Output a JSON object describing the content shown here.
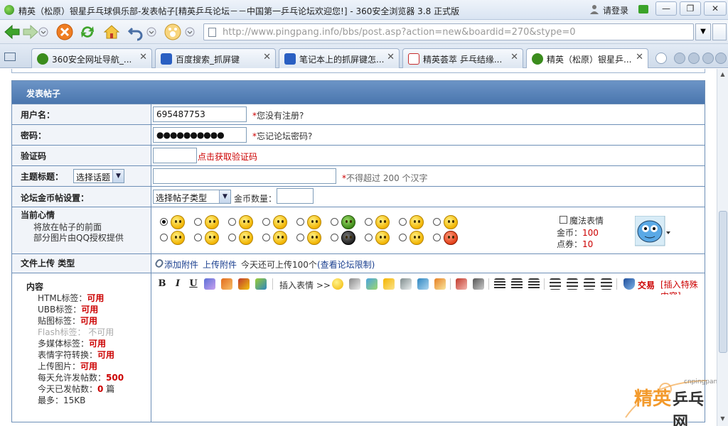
{
  "browser": {
    "title": "精英（松原）银星乒乓球俱乐部-发表帖子[精英乒乓论坛－－中国第一乒乓论坛欢迎您!] - 360安全浏览器 3.8 正式版",
    "login_label": "请登录",
    "url_host": "http://www.pingpang.info",
    "url_path": "/bbs/post.asp?action=new&boardid=270&stype=0",
    "window_buttons": [
      "—",
      "❐",
      "✕"
    ],
    "tabs": [
      {
        "label": "360安全网址导航_...",
        "icon_color": "#3b8c1d"
      },
      {
        "label": "百度搜索_抓屏键",
        "icon_color": "#2a5fc2"
      },
      {
        "label": "笔记本上的抓屏键怎...",
        "icon_color": "#2a5fc2"
      },
      {
        "label": "精英荟萃 乒乓结缘...",
        "icon_color": "#c62b2b"
      },
      {
        "label": "精英（松原）银星乒...",
        "icon_color": "#3b8c1d",
        "active": true
      }
    ]
  },
  "form": {
    "header": "发表帖子",
    "username_label": "用户名：",
    "username_value": "695487753",
    "username_note": "您没有注册?",
    "password_label": "密码：",
    "password_value": "●●●●●●●●●●",
    "password_note": "忘记论坛密码?",
    "captcha_label": "验证码",
    "captcha_link": "点击获取验证码",
    "subject_label": "主题标题：",
    "subject_select": "选择话题",
    "subject_note_prefix": "*",
    "subject_note": "不得超过 200 个汉字",
    "required_star": "*",
    "coin_label": "论坛金币帖设置：",
    "coin_select": "选择帖子类型",
    "coin_amount_label": "金币数量：",
    "mood_label": "当前心情",
    "mood_sub1": "将放在帖子的前面",
    "mood_sub2": "部分图片由QQ授权提供",
    "magic_label": "魔法表情",
    "gold_label": "金币：",
    "gold_value": "100",
    "points_label": "点券：",
    "points_value": "10",
    "upload_label": "文件上传",
    "upload_type": "类型",
    "upload_add": "添加附件",
    "upload_attach": "上传附件",
    "upload_today_prefix": "今天还可上传",
    "upload_today_count": "100",
    "upload_today_suffix": "个",
    "upload_limit_link": "(查看论坛限制)",
    "content_label": "内容",
    "content_rules": [
      {
        "k": "HTML标签：",
        "v": "可用"
      },
      {
        "k": "UBB标签：",
        "v": "可用"
      },
      {
        "k": "贴图标签：",
        "v": "可用"
      },
      {
        "k": "Flash标签：",
        "v": "不可用",
        "disabled": true
      },
      {
        "k": "多媒体标签：",
        "v": "可用"
      },
      {
        "k": "表情字符转换：",
        "v": "可用"
      },
      {
        "k": "上传图片：",
        "v": "可用"
      },
      {
        "k": "每天允许发帖数：",
        "v": "500"
      },
      {
        "k": "今天已发帖数：",
        "v": "0",
        "suffix": " 篇"
      },
      {
        "k": "最多：",
        "v": "15KB",
        "plain": true
      }
    ],
    "toolbar": {
      "bold": "B",
      "italic": "I",
      "underline": "U",
      "insert_emoticon": "插入表情 >>",
      "trade": "交易",
      "insert_special": "[插入特殊内容]"
    }
  },
  "watermark": {
    "site": "cnpingpang.info",
    "text1": "精英",
    "text2": "乒乓网"
  }
}
